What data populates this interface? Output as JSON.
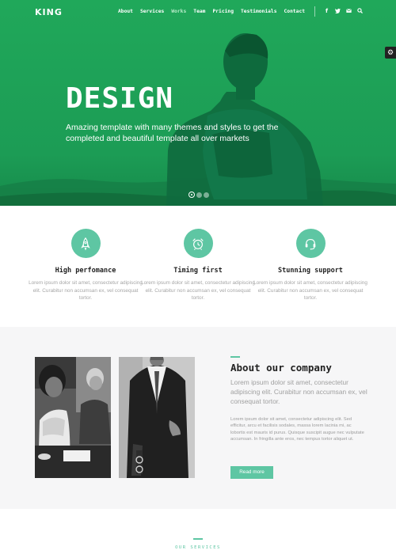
{
  "header": {
    "logo": "KING",
    "menu": [
      "About",
      "Services",
      "Works",
      "Team",
      "Pricing",
      "Testimonials",
      "Contact"
    ],
    "active_menu_item": "Works",
    "social_icons": [
      "facebook-icon",
      "twitter-icon",
      "mail-icon",
      "search-icon"
    ]
  },
  "hero": {
    "title": "DESIGN",
    "subtitle": "Amazing template with many themes and styles to get the completed and beautiful template all over markets",
    "slides": 3,
    "active_slide": 1,
    "background_color": "#1fa257"
  },
  "features": [
    {
      "icon": "rocket-icon",
      "title": "High perfomance",
      "text": "Lorem ipsum dolor sit amet, consectetur adipiscing elit. Curabitur non accumsan ex, vel consequat tortor."
    },
    {
      "icon": "alarm-clock-icon",
      "title": "Timing first",
      "text": "Lorem ipsum dolor sit amet, consectetur adipiscing elit. Curabitur non accumsan ex, vel consequat tortor."
    },
    {
      "icon": "headset-icon",
      "title": "Stunning support",
      "text": "Lorem ipsum dolor sit amet, consectetur adipiscing elit. Curabitur non accumsan ex, vel consequat tortor."
    }
  ],
  "about": {
    "title": "About our company",
    "lead": "Lorem ipsum dolor sit amet, consectetur adipiscing elit. Curabitur non accumsan ex, vel consequat tortor.",
    "text": "Lorem ipsum dolor sit amet, consectetur adipiscing elit. Sed efficitur, arcu et facilisis sodales, massa lorem lacinia mi, ac lobortis est mauris id purus. Quisque suscipit augue nec vulputate accumsan. In fringilla ante eros, nec tempus tortor aliquet ut.",
    "button": "Read more"
  },
  "services": {
    "label": "OUR SERVICES"
  },
  "colors": {
    "brand_green": "#1fa257",
    "accent_mint": "#5ec6a3",
    "section_gray": "#f6f6f7"
  }
}
